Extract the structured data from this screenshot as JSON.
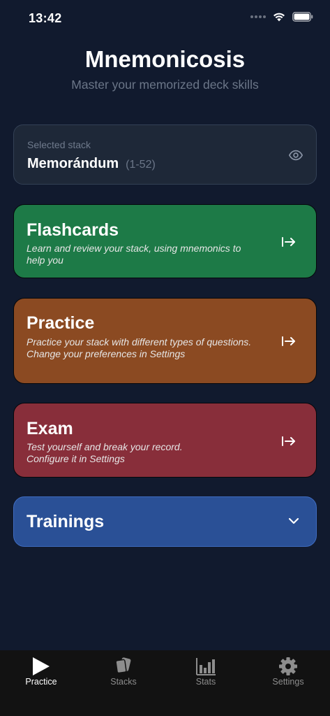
{
  "status_bar": {
    "time": "13:42"
  },
  "header": {
    "title": "Mnemonicosis",
    "subtitle": "Master your memorized deck skills"
  },
  "selected_stack": {
    "caption": "Selected stack",
    "name": "Memorándum",
    "range": "(1-52)"
  },
  "modes": {
    "flashcards": {
      "title": "Flashcards",
      "description": "Learn and review your stack, using mnemonics to help you",
      "color": "#1d7a47"
    },
    "practice": {
      "title": "Practice",
      "description_line1": "Practice your stack with different types of questions.",
      "description_line2": "Change your preferences in Settings",
      "color": "#8b4a22"
    },
    "exam": {
      "title": "Exam",
      "description_line1": "Test yourself and break your record.",
      "description_line2": "Configure it in Settings",
      "color": "#882e3a"
    },
    "trainings": {
      "title": "Trainings",
      "color": "#2a5096"
    }
  },
  "tab_bar": {
    "active": "Practice",
    "tabs": [
      {
        "label": "Practice",
        "icon": "play-icon"
      },
      {
        "label": "Stacks",
        "icon": "cards-icon"
      },
      {
        "label": "Stats",
        "icon": "bar-chart-icon"
      },
      {
        "label": "Settings",
        "icon": "gear-icon"
      }
    ]
  }
}
